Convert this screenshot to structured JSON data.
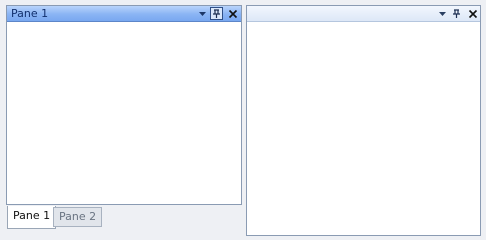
{
  "left_pane": {
    "title": "Pane 1",
    "buttons": {
      "menu_icon": "dropdown-arrow",
      "pin_icon": "pin",
      "close_icon": "close-x"
    }
  },
  "right_pane": {
    "title": "",
    "buttons": {
      "menu_icon": "dropdown-arrow",
      "pin_icon": "pin",
      "close_icon": "close-x"
    }
  },
  "tabs": [
    {
      "label": "Pane 1",
      "active": true
    },
    {
      "label": "Pane 2",
      "active": false
    }
  ],
  "colors": {
    "active_header": "#8ab4f4",
    "inactive_header": "#dde8f7",
    "pane_border": "#8a9bb3",
    "background": "#eef0f4"
  }
}
